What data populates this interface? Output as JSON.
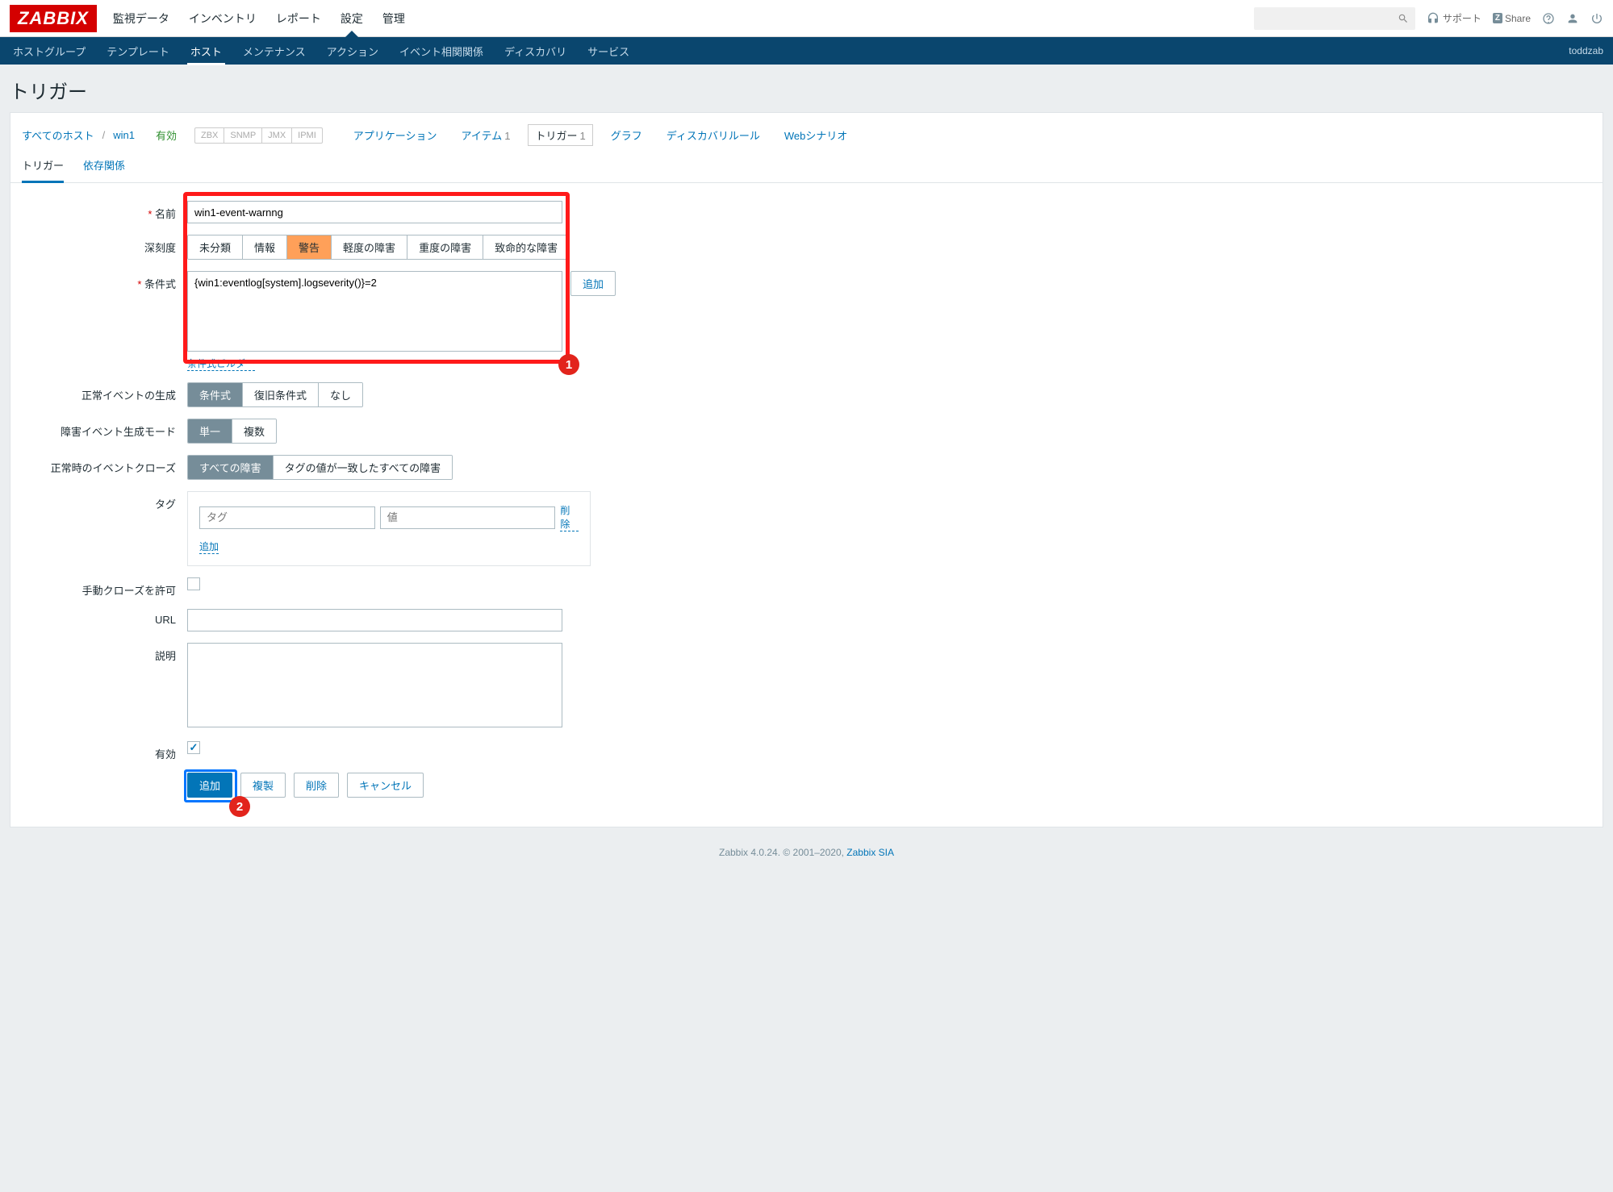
{
  "brand": "ZABBIX",
  "topnav": [
    "監視データ",
    "インベントリ",
    "レポート",
    "設定",
    "管理"
  ],
  "topnavActive": 3,
  "topRight": {
    "support": "サポート",
    "share": "Share"
  },
  "subnav": [
    "ホストグループ",
    "テンプレート",
    "ホスト",
    "メンテナンス",
    "アクション",
    "イベント相関関係",
    "ディスカバリ",
    "サービス"
  ],
  "subnavActive": 2,
  "user": "toddzab",
  "pageTitle": "トリガー",
  "crumbs": {
    "allHosts": "すべてのホスト",
    "host": "win1",
    "enabled": "有効",
    "interfaces": [
      "ZBX",
      "SNMP",
      "JMX",
      "IPMI"
    ],
    "tabs": [
      {
        "label": "アプリケーション",
        "count": ""
      },
      {
        "label": "アイテム",
        "count": "1"
      },
      {
        "label": "トリガー",
        "count": "1",
        "boxed": true
      },
      {
        "label": "グラフ",
        "count": ""
      },
      {
        "label": "ディスカバリルール",
        "count": ""
      },
      {
        "label": "Webシナリオ",
        "count": ""
      }
    ]
  },
  "formTabs": [
    "トリガー",
    "依存関係"
  ],
  "labels": {
    "name": "名前",
    "severity": "深刻度",
    "expression": "条件式",
    "exprBuilder": "条件式ビルダー",
    "okGen": "正常イベントの生成",
    "probMode": "障害イベント生成モード",
    "okClose": "正常時のイベントクローズ",
    "tags": "タグ",
    "manualClose": "手動クローズを許可",
    "url": "URL",
    "desc": "説明",
    "enabled": "有効"
  },
  "values": {
    "name": "win1-event-warnng",
    "expression": "{win1:eventlog[system].logseverity()}=2"
  },
  "severityOpts": [
    "未分類",
    "情報",
    "警告",
    "軽度の障害",
    "重度の障害",
    "致命的な障害"
  ],
  "severitySel": 2,
  "okGenOpts": [
    "条件式",
    "復旧条件式",
    "なし"
  ],
  "okGenSel": 0,
  "probModeOpts": [
    "単一",
    "複数"
  ],
  "probModeSel": 0,
  "okCloseOpts": [
    "すべての障害",
    "タグの値が一致したすべての障害"
  ],
  "okCloseSel": 0,
  "buttons": {
    "add": "追加",
    "tagPh": "タグ",
    "valPh": "値",
    "remove": "削除",
    "addSmall": "追加",
    "submitAdd": "追加",
    "clone": "複製",
    "delete": "削除",
    "cancel": "キャンセル"
  },
  "footer": {
    "text": "Zabbix 4.0.24. © 2001–2020, ",
    "link": "Zabbix SIA"
  }
}
